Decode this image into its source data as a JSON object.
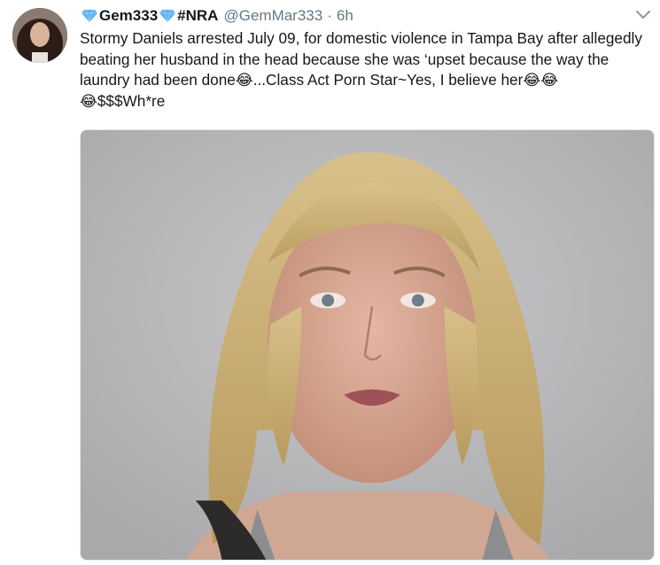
{
  "tweet": {
    "display_name_part1": "Gem333",
    "display_name_part2": "#NRA",
    "handle": "@GemMar333",
    "separator": "·",
    "time": "6h",
    "text_main": "Stormy Daniels arrested July 09, for domestic violence in Tampa Bay after allegedly beating her husband in the head because she was ‘upset because the way the laundry had been done",
    "emoji_1": "😂",
    "text_2": "...Class Act Porn Star~Yes, I believe her",
    "emoji_2": "😂😂",
    "emoji_3": "😂",
    "text_3": "$$$Wh*re"
  },
  "icons": {
    "gem": "gem-stone-icon",
    "caret": "chevron-down-icon"
  },
  "colors": {
    "secondary_text": "#657786",
    "gem_blue": "#5fb3f0"
  }
}
